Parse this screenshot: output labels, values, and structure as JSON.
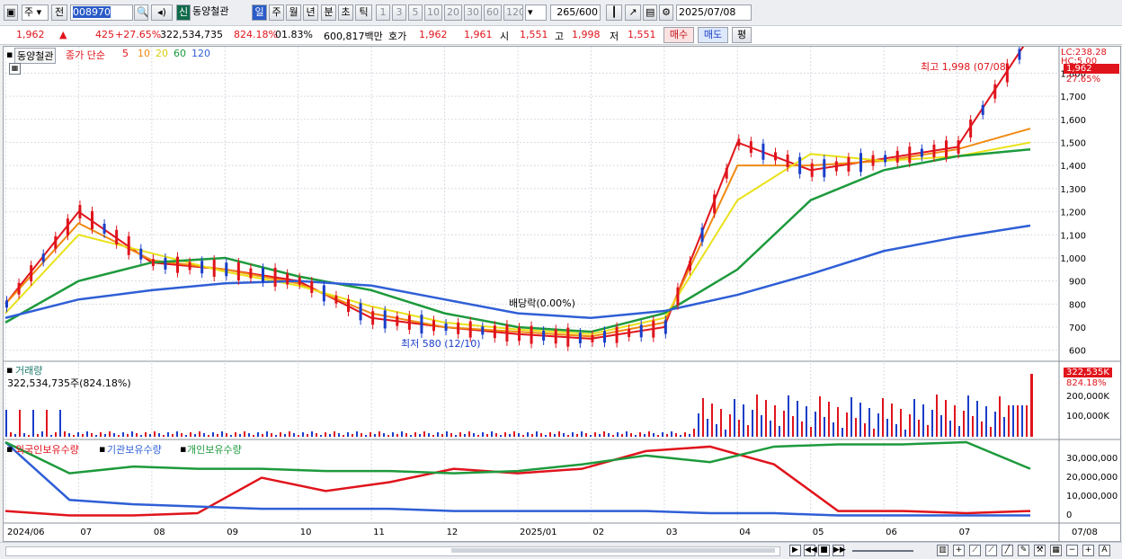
{
  "toolbar": {
    "market": "주",
    "prev_label": "전",
    "code": "008970",
    "new_badge": "신",
    "stock_name": "동양철관",
    "periods": [
      "일",
      "주",
      "월",
      "년",
      "분",
      "초",
      "틱"
    ],
    "intervals": [
      "1",
      "3",
      "5",
      "10",
      "20",
      "30",
      "60",
      "120"
    ],
    "count": "265",
    "count_total": "/600",
    "date": "2025/07/08"
  },
  "quote": {
    "price": "1,962",
    "change_arrow": "▲",
    "change": "425",
    "change_pct": "+27.65%",
    "volume": "322,534,735",
    "volume_ratio": "824.18%",
    "turnover_pct": "01.83%",
    "amount": "600,817백만",
    "bid_label": "호가",
    "ask": "1,962",
    "bid": "1,961",
    "open_label": "시",
    "open": "1,551",
    "high_label": "고",
    "high": "1,998",
    "low_label": "저",
    "low": "1,551",
    "buy_button": "매수",
    "sell_button": "매도",
    "avg_button": "평"
  },
  "price_panel": {
    "stock_tag": "동양철관",
    "ma_prefix": "종가 단순",
    "ma_periods": [
      {
        "label": "5",
        "color": "#e0141c"
      },
      {
        "label": "10",
        "color": "#f08a12"
      },
      {
        "label": "20",
        "color": "#e9e21a"
      },
      {
        "label": "60",
        "color": "#1d9a3c"
      },
      {
        "label": "120",
        "color": "#2f5fd6"
      }
    ],
    "lc_label": "LC:238.28",
    "hc_label": "HC:5.00",
    "last_price_badge": "1,962",
    "last_change_badge": "27.65%",
    "high_annotation": "최고 1,998 (07/08)",
    "low_annotation": "최저 580 (12/10)",
    "dividend_annotation": "배당락(0.00%)",
    "y_ticks": [
      "1,800",
      "1,700",
      "1,600",
      "1,500",
      "1,400",
      "1,300",
      "1,200",
      "1,100",
      "1,000",
      "900",
      "800",
      "700",
      "600"
    ]
  },
  "volume_panel": {
    "title": "거래량",
    "subtitle": "322,534,735주(824.18%)",
    "last_badge": "322,535K",
    "last_pct": "824.18%",
    "y_ticks": [
      "200,000K",
      "100,000K"
    ]
  },
  "holdings_panel": {
    "legend": [
      {
        "label": "외국인보유수량",
        "color": "#e0141c"
      },
      {
        "label": "기관보유수량",
        "color": "#2f5fd6"
      },
      {
        "label": "개인보유수량",
        "color": "#1d9a3c"
      }
    ],
    "y_ticks": [
      "30,000,000",
      "20,000,000",
      "10,000,000",
      "0"
    ]
  },
  "x_axis": {
    "ticks": [
      "2024/06",
      "07",
      "08",
      "09",
      "10",
      "11",
      "12",
      "2025/01",
      "02",
      "03",
      "04",
      "05",
      "06",
      "07",
      "07/08"
    ]
  },
  "colors": {
    "candle_up": "#e0141c",
    "candle_down": "#1a3ec9",
    "grid": "#d8dbe2"
  },
  "chart_data": {
    "type": "line",
    "title": "동양철관",
    "x": [
      "2024/06",
      "07",
      "08",
      "09",
      "10",
      "11",
      "12",
      "2025/01",
      "02",
      "03",
      "04",
      "05",
      "06",
      "07",
      "07/08"
    ],
    "series": [
      {
        "name": "5",
        "values": [
          800,
          1200,
          980,
          950,
          900,
          740,
          700,
          670,
          650,
          700,
          1500,
          1380,
          1430,
          1480,
          1962
        ]
      },
      {
        "name": "10",
        "values": [
          800,
          1150,
          990,
          950,
          890,
          760,
          700,
          680,
          660,
          720,
          1400,
          1400,
          1420,
          1470,
          1560
        ]
      },
      {
        "name": "20",
        "values": [
          760,
          1100,
          1020,
          940,
          880,
          790,
          720,
          690,
          670,
          740,
          1250,
          1450,
          1420,
          1440,
          1500
        ]
      },
      {
        "name": "60",
        "values": [
          720,
          900,
          980,
          1000,
          920,
          860,
          760,
          700,
          680,
          760,
          950,
          1250,
          1380,
          1440,
          1470
        ]
      },
      {
        "name": "120",
        "values": [
          740,
          820,
          860,
          890,
          900,
          880,
          820,
          760,
          740,
          770,
          840,
          930,
          1030,
          1090,
          1140
        ]
      }
    ],
    "ylim": [
      560,
      1860
    ]
  }
}
